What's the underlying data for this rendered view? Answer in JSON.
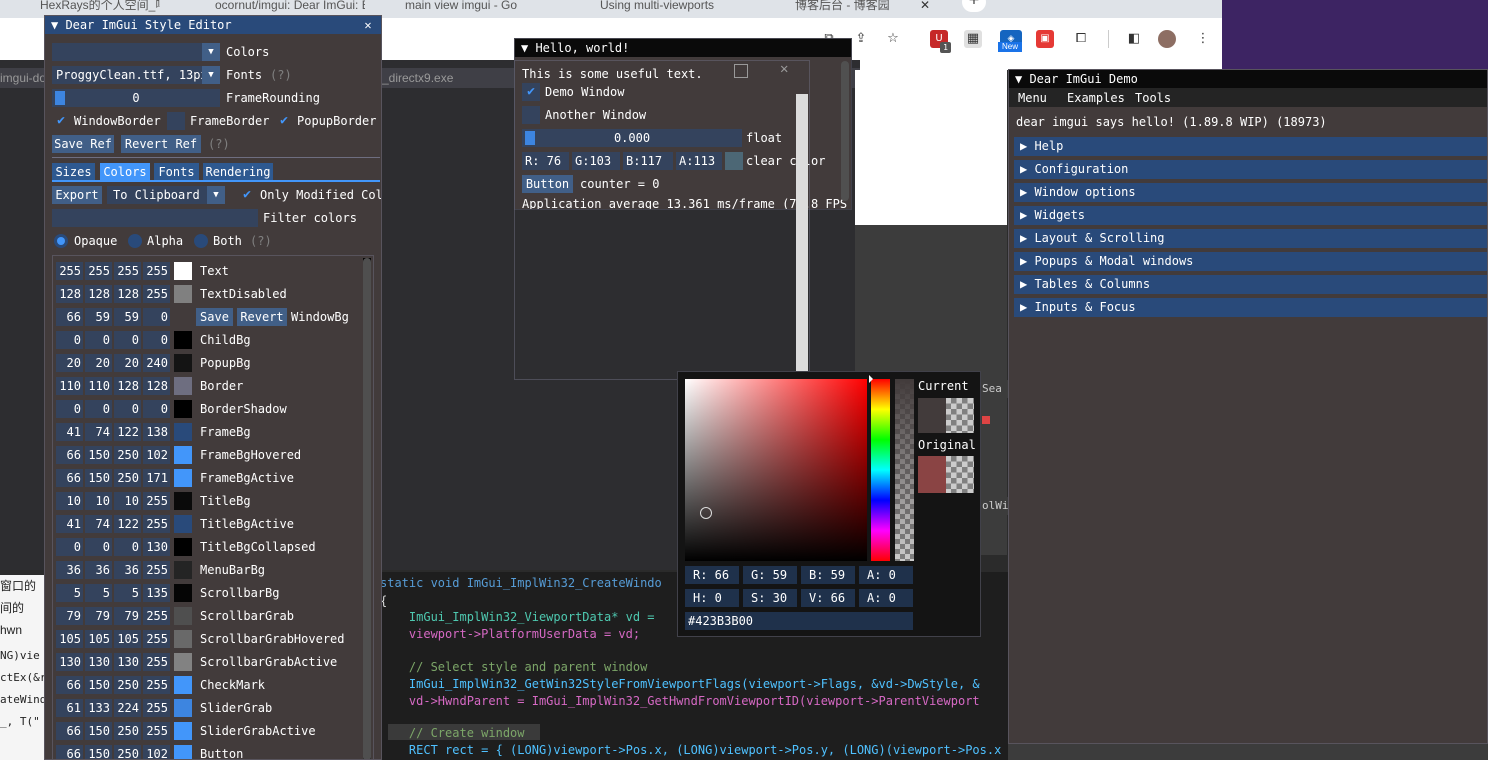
{
  "browser": {
    "tabs": [
      "HexRays的个人空间_哔",
      "ocornut/imgui: Dear ImGui: Bloat-free",
      "main view imgui - Go",
      "Using multi-viewports",
      "博客后台 - 博客园"
    ],
    "new_badge": "New",
    "ext_badge": "1"
  },
  "vs": {
    "tab_left": "imgui-do",
    "tab_right": "_directx9.exe"
  },
  "web_left": {
    "lines": [
      "窗口的",
      "间的hwn",
      "",
      "NG)vie",
      "ctEx(&r",
      "ateWind",
      "_, T(\""
    ]
  },
  "code": {
    "lines": [
      {
        "t": "static void ImGui_ImplWin32_CreateWindo",
        "c": "fn"
      },
      {
        "t": "{",
        "c": "p"
      },
      {
        "t": "    ImGui_ImplWin32_ViewportData* vd =",
        "c": "ty"
      },
      {
        "t": "    viewport->PlatformUserData = vd;",
        "c": "m"
      },
      {
        "t": "",
        "c": "p"
      },
      {
        "t": "    // Select style and parent window",
        "c": "cm"
      },
      {
        "t": "    ImGui_ImplWin32_GetWin32StyleFromViewportFlags(viewport->Flags, &vd->DwStyle, &",
        "c": "fn"
      },
      {
        "t": "    vd->HwndParent = ImGui_ImplWin32_GetHwndFromViewportID(viewport->ParentViewport",
        "c": "m"
      },
      {
        "t": "",
        "c": "p"
      },
      {
        "t": "    // Create window",
        "c": "cm"
      },
      {
        "t": "    RECT rect = { (LONG)viewport->Pos.x, (LONG)viewport->Pos.y, (LONG)(viewport->Pos.x + viewport->Size.x), (L",
        "c": "m"
      }
    ]
  },
  "style_editor": {
    "title": "Dear ImGui Style Editor",
    "colors_label": "Colors",
    "font_value": "ProggyClean.ttf, 13px",
    "fonts_label": "Fonts",
    "help": "(?)",
    "rounding_value": "0",
    "rounding_label": "FrameRounding",
    "window_border": "WindowBorder",
    "frame_border": "FrameBorder",
    "popup_border": "PopupBorder",
    "save_ref": "Save Ref",
    "revert_ref": "Revert Ref",
    "tabs": [
      "Sizes",
      "Colors",
      "Fonts",
      "Rendering"
    ],
    "export": "Export",
    "to_clipboard": "To Clipboard",
    "only_modified": "Only Modified Col",
    "filter": "Filter colors",
    "opaque": "Opaque",
    "alpha": "Alpha",
    "both": "Both",
    "save": "Save",
    "revert": "Revert",
    "colors": [
      {
        "r": "255",
        "g": "255",
        "b": "255",
        "a": "255",
        "name": "Text",
        "hex": "#ffffff"
      },
      {
        "r": "128",
        "g": "128",
        "b": "128",
        "a": "255",
        "name": "TextDisabled",
        "hex": "#808080"
      },
      {
        "r": "66",
        "g": "59",
        "b": "59",
        "a": "0",
        "name": "WindowBg",
        "hex": "#423b3b"
      },
      {
        "r": "0",
        "g": "0",
        "b": "0",
        "a": "0",
        "name": "ChildBg",
        "hex": "#000000"
      },
      {
        "r": "20",
        "g": "20",
        "b": "20",
        "a": "240",
        "name": "PopupBg",
        "hex": "#141414"
      },
      {
        "r": "110",
        "g": "110",
        "b": "128",
        "a": "128",
        "name": "Border",
        "hex": "#6e6e80"
      },
      {
        "r": "0",
        "g": "0",
        "b": "0",
        "a": "0",
        "name": "BorderShadow",
        "hex": "#000000"
      },
      {
        "r": "41",
        "g": "74",
        "b": "122",
        "a": "138",
        "name": "FrameBg",
        "hex": "#294a7a"
      },
      {
        "r": "66",
        "g": "150",
        "b": "250",
        "a": "102",
        "name": "FrameBgHovered",
        "hex": "#4296fa"
      },
      {
        "r": "66",
        "g": "150",
        "b": "250",
        "a": "171",
        "name": "FrameBgActive",
        "hex": "#4296fa"
      },
      {
        "r": "10",
        "g": "10",
        "b": "10",
        "a": "255",
        "name": "TitleBg",
        "hex": "#0a0a0a"
      },
      {
        "r": "41",
        "g": "74",
        "b": "122",
        "a": "255",
        "name": "TitleBgActive",
        "hex": "#294a7a"
      },
      {
        "r": "0",
        "g": "0",
        "b": "0",
        "a": "130",
        "name": "TitleBgCollapsed",
        "hex": "#000000"
      },
      {
        "r": "36",
        "g": "36",
        "b": "36",
        "a": "255",
        "name": "MenuBarBg",
        "hex": "#242424"
      },
      {
        "r": "5",
        "g": "5",
        "b": "5",
        "a": "135",
        "name": "ScrollbarBg",
        "hex": "#050505"
      },
      {
        "r": "79",
        "g": "79",
        "b": "79",
        "a": "255",
        "name": "ScrollbarGrab",
        "hex": "#4f4f4f"
      },
      {
        "r": "105",
        "g": "105",
        "b": "105",
        "a": "255",
        "name": "ScrollbarGrabHovered",
        "hex": "#696969"
      },
      {
        "r": "130",
        "g": "130",
        "b": "130",
        "a": "255",
        "name": "ScrollbarGrabActive",
        "hex": "#828282"
      },
      {
        "r": "66",
        "g": "150",
        "b": "250",
        "a": "255",
        "name": "CheckMark",
        "hex": "#4296fa"
      },
      {
        "r": "61",
        "g": "133",
        "b": "224",
        "a": "255",
        "name": "SliderGrab",
        "hex": "#3d85e0"
      },
      {
        "r": "66",
        "g": "150",
        "b": "250",
        "a": "255",
        "name": "SliderGrabActive",
        "hex": "#4296fa"
      },
      {
        "r": "66",
        "g": "150",
        "b": "250",
        "a": "102",
        "name": "Button",
        "hex": "#4296fa"
      }
    ]
  },
  "hello": {
    "title": "Hello, world!",
    "useful": "This is some useful text.",
    "demo_window": "Demo Window",
    "another_window": "Another Window",
    "float_value": "0.000",
    "float_label": "float",
    "r": "R: 76",
    "g": "G:103",
    "b": "B:117",
    "a": "A:113",
    "clear_color": "clear color",
    "clear_hex": "#4c6775",
    "button": "Button",
    "counter": "counter = 0",
    "average": "Application average 13.361 ms/frame (74.8 FPS"
  },
  "picker": {
    "current": "Current",
    "original": "Original",
    "r": "R: 66",
    "g": "G: 59",
    "b": "B: 59",
    "a": "A: 0",
    "h": "H: 0",
    "s": "S: 30",
    "v": "V: 66",
    "a2": "A: 0",
    "hex": "#423B3B00",
    "side_search": "Sea",
    "side_win": "olWin"
  },
  "demo": {
    "title": "Dear ImGui Demo",
    "menu": [
      "Menu",
      "Examples",
      "Tools"
    ],
    "hello": "dear imgui says hello! (1.89.8 WIP) (18973)",
    "headers": [
      "Help",
      "Configuration",
      "Window options",
      "Widgets",
      "Layout & Scrolling",
      "Popups & Modal windows",
      "Tables & Columns",
      "Inputs & Focus"
    ]
  }
}
